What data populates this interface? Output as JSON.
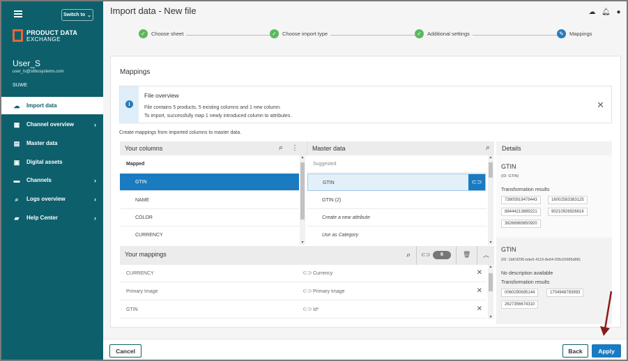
{
  "app": {
    "brand_line1": "PRODUCT DATA",
    "brand_line2": "EXCHANGE",
    "switch_label": "Switch to",
    "user_name": "User_S",
    "user_email": "user_ts@stibosystems.com",
    "org": "SUWE"
  },
  "nav": [
    {
      "label": "Import data",
      "icon": "cloud-upload-icon"
    },
    {
      "label": "Channel overview",
      "icon": "grid-icon"
    },
    {
      "label": "Master data",
      "icon": "table-icon"
    },
    {
      "label": "Digital assets",
      "icon": "image-icon"
    },
    {
      "label": "Channels",
      "icon": "stack-icon"
    },
    {
      "label": "Logs overview",
      "icon": "search-icon"
    },
    {
      "label": "Help Center",
      "icon": "chat-icon"
    }
  ],
  "header": {
    "title": "Import data - New file"
  },
  "steps": [
    {
      "label": "Choose sheet",
      "state": "done"
    },
    {
      "label": "Choose import type",
      "state": "done"
    },
    {
      "label": "Additional settings",
      "state": "done"
    },
    {
      "label": "Mappings",
      "state": "current"
    }
  ],
  "mappings": {
    "title": "Mappings",
    "info_title": "File overview",
    "info_line1": "File contains 5 products, 5 existing columns and 1 new column.",
    "info_line2": "To import, successfully map 1 newly introduced column to attributes.",
    "hint": "Create mappings from imported columns to master data."
  },
  "your_columns": {
    "title": "Your columns",
    "group": "Mapped",
    "items": [
      "GTIN",
      "NAME",
      "COLOR",
      "CURRENCY"
    ]
  },
  "master_data": {
    "title": "Master data",
    "group": "Suggested",
    "items": [
      "GTIN",
      "GTIN (2)",
      "Create a new attribute",
      "Use as Category"
    ]
  },
  "your_mappings": {
    "title": "Your mappings",
    "count": "6",
    "rows": [
      {
        "source": "CURRENCY",
        "target": "Currency"
      },
      {
        "source": "Primary Image",
        "target": "Primary Image"
      },
      {
        "source": "GTIN",
        "target": "Id",
        "required": "*"
      }
    ]
  },
  "details": {
    "title": "Details",
    "block1": {
      "name": "GTIN",
      "id": "(ID: GTIN)",
      "results_label": "Transformation results",
      "chips": [
        "73805919479443",
        "16002583383125",
        "88444213699221",
        "90210926926616",
        "38266969650920"
      ]
    },
    "block2": {
      "name": "GTIN",
      "id": "(ID: 1b81f295-bde6-4110-8e64-f28c02685d88)",
      "desc": "No description available",
      "results_label": "Transformation results",
      "chips": [
        "0060290695144",
        "1704948783993",
        "2627356674310"
      ]
    }
  },
  "footer": {
    "cancel": "Cancel",
    "back": "Back",
    "apply": "Apply"
  },
  "colors": {
    "sidebar": "#0d5f6b",
    "primary": "#1a7bc0",
    "accent": "#e8663a",
    "success": "#5cb85c",
    "arrow": "#8b1a1a"
  }
}
